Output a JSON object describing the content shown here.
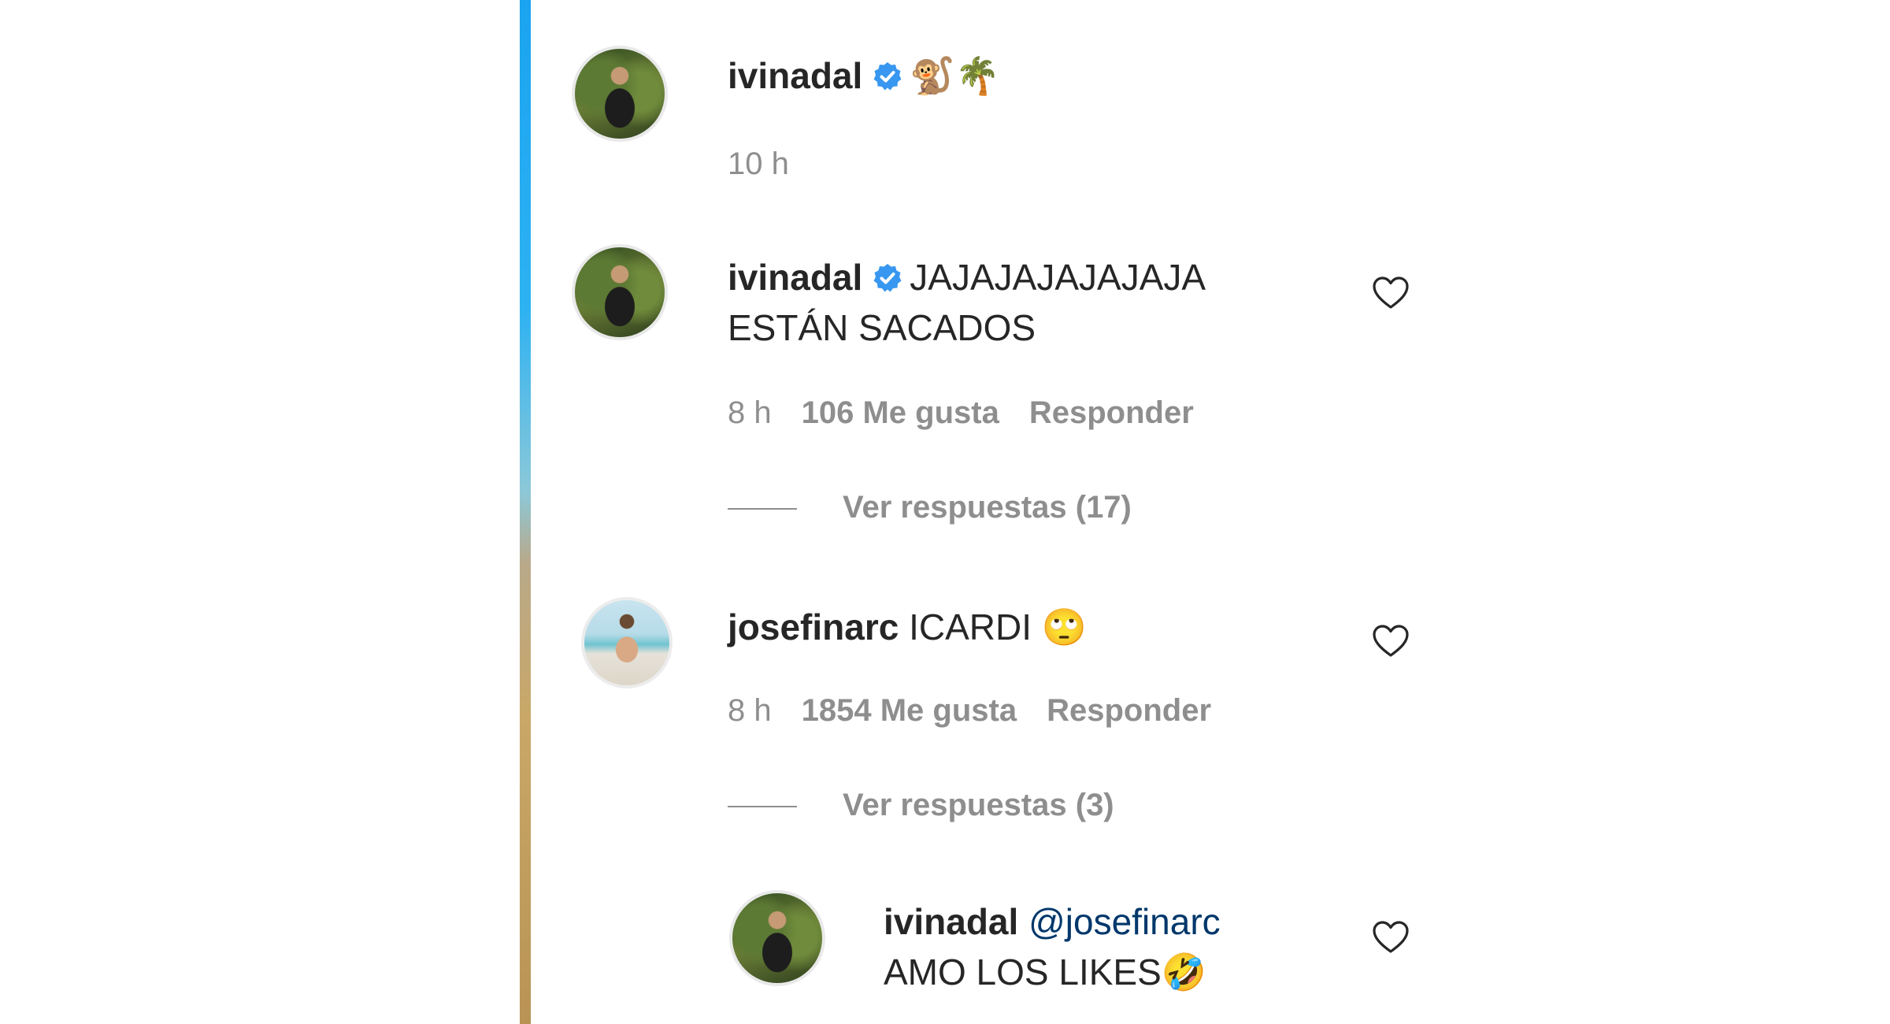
{
  "comments": [
    {
      "username": "ivinadal",
      "verified": true,
      "text": "🐒🌴",
      "time": "10 h",
      "avatar_icon": "avatar-woman-swimsuit"
    },
    {
      "username": "ivinadal",
      "verified": true,
      "text_line1": "JAJAJAJAJAJAJA",
      "text_line2": "ESTÁN SACADOS",
      "time": "8 h",
      "likes": "106 Me gusta",
      "reply": "Responder",
      "view_replies": "Ver respuestas (17)",
      "avatar_icon": "avatar-woman-swimsuit"
    },
    {
      "username": "josefinarc",
      "verified": false,
      "text": "ICARDI",
      "emoji": "🙄",
      "time": "8 h",
      "likes": "1854 Me gusta",
      "reply": "Responder",
      "view_replies": "Ver respuestas (3)",
      "avatar_icon": "avatar-woman-beach"
    },
    {
      "username": "ivinadal",
      "verified": false,
      "mention": "@josefinarc",
      "text_line2": "AMO LOS LIKES",
      "emoji": "🤣",
      "avatar_icon": "avatar-woman-swimsuit"
    }
  ],
  "colors": {
    "verified_blue": "#3897f0",
    "mention": "#00376b",
    "secondary_text": "#8e8e8e",
    "primary_text": "#262626"
  },
  "icons": {
    "verified": "verified-badge-icon",
    "like": "heart-outline-icon"
  }
}
